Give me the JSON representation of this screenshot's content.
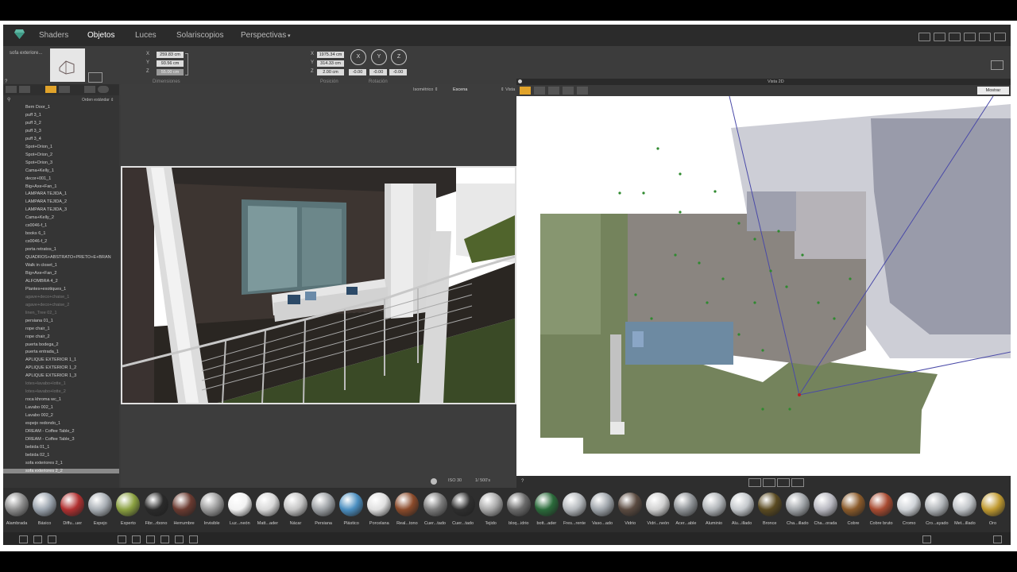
{
  "menu": {
    "shaders": "Shaders",
    "objects": "Objetos",
    "lights": "Luces",
    "solariscopes": "Solariscopios",
    "perspectives": "Perspectivas",
    "perspectives_arrow": "▾"
  },
  "props": {
    "object_name": "sofa exteriore...",
    "dim_x_label": "X",
    "dim_y_label": "Y",
    "dim_z_label": "Z",
    "dim_x": "259.83 cm",
    "dim_y": "93.56 cm",
    "dim_z": "55.00 cm",
    "dimensions_label": "Dimensiones",
    "pos_x_label": "X",
    "pos_y_label": "Y",
    "pos_z_label": "Z",
    "pos_x": "1975.34 cm",
    "pos_y": "314.33 cm",
    "pos_z": "2.00 cm",
    "position_label": "Posición",
    "rotation_label": "Rotación",
    "rot_x_label": "X",
    "rot_y_label": "Y",
    "rot_z_label": "Z",
    "rot_x": "-0.00",
    "rot_y": "-0.00",
    "rot_z": "-0.00"
  },
  "leftpanel": {
    "order_label": "Orden estándar ⇕",
    "help": "?",
    "items": [
      {
        "label": "Bem Door_1",
        "state": "normal"
      },
      {
        "label": "puff 3_1",
        "state": "normal"
      },
      {
        "label": "puff 3_2",
        "state": "normal"
      },
      {
        "label": "puff 3_3",
        "state": "normal"
      },
      {
        "label": "puff 3_4",
        "state": "normal"
      },
      {
        "label": "Spot+Orion_1",
        "state": "normal"
      },
      {
        "label": "Spot+Orion_2",
        "state": "normal"
      },
      {
        "label": "Spot+Orion_3",
        "state": "normal"
      },
      {
        "label": "Cama+Kelly_1",
        "state": "normal"
      },
      {
        "label": "decor+001_1",
        "state": "normal"
      },
      {
        "label": "Big+Axe+Fan_1",
        "state": "normal"
      },
      {
        "label": "LAMPARA TEJIDA_1",
        "state": "normal"
      },
      {
        "label": "LAMPARA TEJIDA_2",
        "state": "normal"
      },
      {
        "label": "LAMPARA TEJIDA_3",
        "state": "normal"
      },
      {
        "label": "Cama+Kelly_2",
        "state": "normal"
      },
      {
        "label": "cs0046-f_1",
        "state": "normal"
      },
      {
        "label": "books 6_1",
        "state": "normal"
      },
      {
        "label": "cs0046-f_2",
        "state": "normal"
      },
      {
        "label": "porta retratos_1",
        "state": "normal"
      },
      {
        "label": "QUADROS+ABSTRATO+PRETO+E+BRAN",
        "state": "normal"
      },
      {
        "label": "Walk in closet_1",
        "state": "normal"
      },
      {
        "label": "Big+Axe+Fan_2",
        "state": "normal"
      },
      {
        "label": "ALFOMBRA 4_2",
        "state": "normal"
      },
      {
        "label": "Plantes+exotiques_1",
        "state": "normal"
      },
      {
        "label": "agave+deco+chaise_1",
        "state": "dim"
      },
      {
        "label": "agave+deco+chaise_2",
        "state": "dim"
      },
      {
        "label": "linen_Tree 02_1",
        "state": "dim"
      },
      {
        "label": "persiana 01_1",
        "state": "normal"
      },
      {
        "label": "rope chair_1",
        "state": "normal"
      },
      {
        "label": "rope chair_2",
        "state": "normal"
      },
      {
        "label": "puerta bodega_2",
        "state": "normal"
      },
      {
        "label": "puerta entrada_1",
        "state": "normal"
      },
      {
        "label": "APLIQUE EXTERIOR 1_1",
        "state": "normal"
      },
      {
        "label": "APLIQUE EXTERIOR 1_2",
        "state": "normal"
      },
      {
        "label": "APLIQUE EXTERIOR 1_3",
        "state": "normal"
      },
      {
        "label": "lotes+lavabo+lotte_1",
        "state": "dim"
      },
      {
        "label": "lotes+lavabo+lotte_2",
        "state": "dim"
      },
      {
        "label": "roca khroma wc_1",
        "state": "normal"
      },
      {
        "label": "Lavabo 002_1",
        "state": "normal"
      },
      {
        "label": "Lavabo 002_2",
        "state": "normal"
      },
      {
        "label": "espejo redondo_1",
        "state": "normal"
      },
      {
        "label": "DREAM - Coffee Table_2",
        "state": "normal"
      },
      {
        "label": "DREAM - Coffee Table_3",
        "state": "normal"
      },
      {
        "label": "bebida 01_1",
        "state": "normal"
      },
      {
        "label": "bebida 02_1",
        "state": "normal"
      },
      {
        "label": "sofa exteriores 2_1",
        "state": "normal"
      },
      {
        "label": "sofa exteriores 2_2",
        "state": "selected"
      }
    ]
  },
  "viewport": {
    "mode": "Isométrico ⇕",
    "scene": "Escena",
    "view": "⇕ Vista",
    "iso": "ISO 30",
    "shutter": "1/ 500's"
  },
  "view2d": {
    "title": "Vista 2D",
    "show_button": "Mostrar",
    "help": "?"
  },
  "materials": [
    {
      "label": "Alambrada",
      "color": "#8c8c8c"
    },
    {
      "label": "Básico",
      "color": "#9aa3ad"
    },
    {
      "label": "Diffu...uer",
      "color": "#b03030"
    },
    {
      "label": "Espejo",
      "color": "#a8aeb4"
    },
    {
      "label": "Experto",
      "color": "#8aa040"
    },
    {
      "label": "Fibr...rbono",
      "color": "#2a2a2a"
    },
    {
      "label": "Herrumbre",
      "color": "#6a3a30"
    },
    {
      "label": "Invisible",
      "color": "#9a9a9a"
    },
    {
      "label": "Luz...neón",
      "color": "#f2f2f2"
    },
    {
      "label": "Matt...ader",
      "color": "#d8d8d8"
    },
    {
      "label": "Nácar",
      "color": "#c4c4c4"
    },
    {
      "label": "Persiana",
      "color": "#9ca0a4"
    },
    {
      "label": "Plástico",
      "color": "#4a8ec0"
    },
    {
      "label": "Porcelana",
      "color": "#e0e0e0"
    },
    {
      "label": "Real...tono",
      "color": "#8a4a2a"
    },
    {
      "label": "Cuer...tado",
      "color": "#7a7a7a"
    },
    {
      "label": "Cuer...tado",
      "color": "#2e2e2e"
    },
    {
      "label": "Tejido",
      "color": "#a8a8a8"
    },
    {
      "label": "bloq...idrio",
      "color": "#6a6a6a"
    },
    {
      "label": "bott...ader",
      "color": "#2a6a3a"
    },
    {
      "label": "Fres...rente",
      "color": "#b4b8bc"
    },
    {
      "label": "Vaso...ado",
      "color": "#9ea4aa"
    },
    {
      "label": "Vidrio",
      "color": "#5a4a40"
    },
    {
      "label": "Vidri...neón",
      "color": "#d0d0d0"
    },
    {
      "label": "Acer...able",
      "color": "#8e9296"
    },
    {
      "label": "Aluminio",
      "color": "#b0b4b8"
    },
    {
      "label": "Alu...illado",
      "color": "#c4c8cc"
    },
    {
      "label": "Bronce",
      "color": "#5a4a20"
    },
    {
      "label": "Cha...illado",
      "color": "#a0a4a8"
    },
    {
      "label": "Cha...orada",
      "color": "#b8b8c0"
    },
    {
      "label": "Cobre",
      "color": "#8a5a2a"
    },
    {
      "label": "Cobre bruto",
      "color": "#a84a30"
    },
    {
      "label": "Cromo",
      "color": "#d0d4d8"
    },
    {
      "label": "Cro...ayado",
      "color": "#b0b4b8"
    },
    {
      "label": "Met...illado",
      "color": "#c0c4c8"
    },
    {
      "label": "Oro",
      "color": "#c09a30"
    }
  ]
}
